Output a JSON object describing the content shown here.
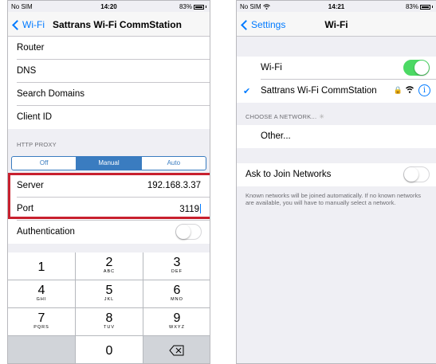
{
  "left": {
    "status": {
      "carrier": "No SIM",
      "time": "14:20",
      "battery": "83%"
    },
    "nav": {
      "back_label": "Wi-Fi",
      "title": "Sattrans Wi-Fi CommStation"
    },
    "rows": {
      "router": "Router",
      "dns": "DNS",
      "search_domains": "Search Domains",
      "client_id": "Client ID"
    },
    "http_proxy_header": "HTTP PROXY",
    "proxy_modes": [
      "Off",
      "Manual",
      "Auto"
    ],
    "proxy_selected": "Manual",
    "server": {
      "label": "Server",
      "value": "192.168.3.37"
    },
    "port": {
      "label": "Port",
      "value": "3119"
    },
    "authentication": {
      "label": "Authentication",
      "enabled": false
    },
    "keypad": [
      {
        "num": "1",
        "letters": ""
      },
      {
        "num": "2",
        "letters": "ABC"
      },
      {
        "num": "3",
        "letters": "DEF"
      },
      {
        "num": "4",
        "letters": "GHI"
      },
      {
        "num": "5",
        "letters": "JKL"
      },
      {
        "num": "6",
        "letters": "MNO"
      },
      {
        "num": "7",
        "letters": "PQRS"
      },
      {
        "num": "8",
        "letters": "TUV"
      },
      {
        "num": "9",
        "letters": "WXYZ"
      },
      {
        "num": "0",
        "letters": ""
      }
    ],
    "delete_icon": "delete-key-icon"
  },
  "right": {
    "status": {
      "carrier": "No SIM",
      "time": "14:21",
      "battery": "83%"
    },
    "nav": {
      "back_label": "Settings",
      "title": "Wi-Fi"
    },
    "wifi": {
      "label": "Wi-Fi",
      "enabled": true
    },
    "connected_network": "Sattrans Wi-Fi CommStation",
    "choose_header": "CHOOSE A NETWORK...",
    "other": "Other...",
    "ask_to_join": {
      "label": "Ask to Join Networks",
      "enabled": false
    },
    "footer": "Known networks will be joined automatically. If no known networks are available, you will have to manually select a network."
  },
  "colors": {
    "accent": "#007aff",
    "toggle_on": "#4cd964",
    "highlight": "#c8202e",
    "segmented": "#3a7cc0"
  }
}
